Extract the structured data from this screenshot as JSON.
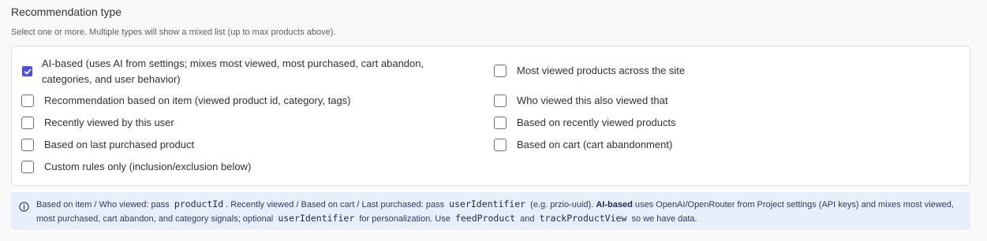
{
  "section": {
    "title": "Recommendation type",
    "help": "Select one or more. Multiple types will show a mixed list (up to max products above)."
  },
  "options": {
    "ai_based": {
      "label": "AI-based (uses AI from settings; mixes most viewed, most purchased, cart abandon,",
      "label_line2": "categories, and user behavior)",
      "checked": true
    },
    "most_viewed": {
      "label": "Most viewed products across the site",
      "checked": false
    },
    "item_based": {
      "label": "Recommendation based on item (viewed product id, category, tags)",
      "checked": false
    },
    "also_viewed": {
      "label": "Who viewed this also viewed that",
      "checked": false
    },
    "recently_viewed_user": {
      "label": "Recently viewed by this user",
      "checked": false
    },
    "based_recently_viewed": {
      "label": "Based on recently viewed products",
      "checked": false
    },
    "last_purchased": {
      "label": "Based on last purchased product",
      "checked": false
    },
    "cart": {
      "label": "Based on cart (cart abandonment)",
      "checked": false
    },
    "custom_rules": {
      "label": "Custom rules only (inclusion/exclusion below)",
      "checked": false
    }
  },
  "info": {
    "t1": "Based on item / Who viewed: pass",
    "c1": "productId",
    "t2": ". Recently viewed / Based on cart / Last purchased: pass",
    "c2": "userIdentifier",
    "t3": "(e.g. przio-uuid).",
    "b1": "AI-based",
    "t4": "uses OpenAI/OpenRouter from Project settings (API keys) and mixes most viewed, most purchased, cart abandon, and category signals; optional",
    "c3": "userIdentifier",
    "t5": "for personalization. Use",
    "c4": "feedProduct",
    "t6": "and",
    "c5": "trackProductView",
    "t7": "so we have data."
  },
  "colors": {
    "accent": "#4a4fe0",
    "info_bg": "#e9eefb"
  },
  "icons": [
    "check-icon",
    "info-icon"
  ]
}
